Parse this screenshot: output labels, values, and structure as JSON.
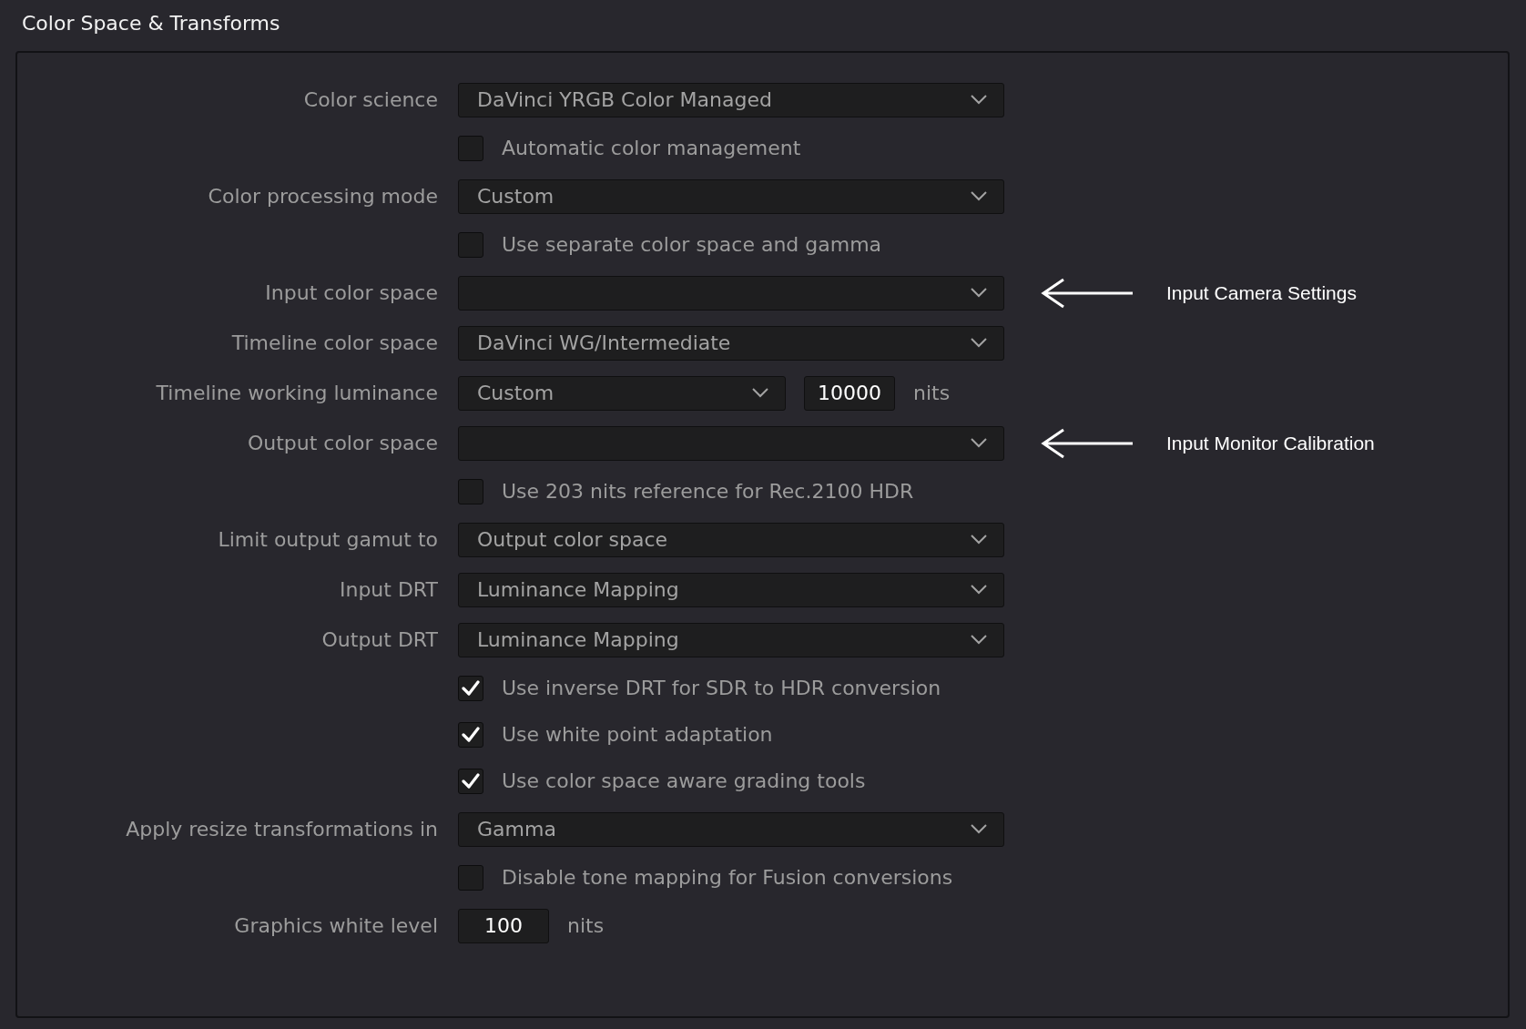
{
  "title": "Color Space & Transforms",
  "rows": [
    {
      "kind": "dropdown",
      "label": "Color science",
      "value": "DaVinci YRGB Color Managed"
    },
    {
      "kind": "checkbox",
      "label": "Automatic color management",
      "checked": false
    },
    {
      "kind": "dropdown",
      "label": "Color processing mode",
      "value": "Custom"
    },
    {
      "kind": "checkbox",
      "label": "Use separate color space and gamma",
      "checked": false
    },
    {
      "kind": "dropdown",
      "label": "Input color space",
      "annotation": "Input Camera Settings"
    },
    {
      "kind": "dropdown",
      "label": "Timeline color space",
      "value": "DaVinci WG/Intermediate"
    },
    {
      "kind": "luminance",
      "label": "Timeline working luminance",
      "value": "Custom",
      "number": "10000",
      "unit": "nits"
    },
    {
      "kind": "dropdown",
      "label": "Output color space",
      "annotation": "Input Monitor Calibration"
    },
    {
      "kind": "checkbox",
      "label": "Use 203 nits reference for Rec.2100 HDR",
      "checked": false
    },
    {
      "kind": "dropdown",
      "label": "Limit output gamut to",
      "value": "Output color space"
    },
    {
      "kind": "dropdown",
      "label": "Input DRT",
      "value": "Luminance Mapping"
    },
    {
      "kind": "dropdown",
      "label": "Output DRT",
      "value": "Luminance Mapping"
    },
    {
      "kind": "checkbox",
      "label": "Use inverse DRT for SDR to HDR conversion",
      "checked": true
    },
    {
      "kind": "checkbox",
      "label": "Use white point adaptation",
      "checked": true
    },
    {
      "kind": "checkbox",
      "label": "Use color space aware grading tools",
      "checked": true
    },
    {
      "kind": "dropdown",
      "label": "Apply resize transformations in",
      "value": "Gamma"
    },
    {
      "kind": "checkbox",
      "label": "Disable tone mapping for Fusion conversions",
      "checked": false
    },
    {
      "kind": "number",
      "label": "Graphics white level",
      "number": "100",
      "unit": "nits"
    }
  ]
}
